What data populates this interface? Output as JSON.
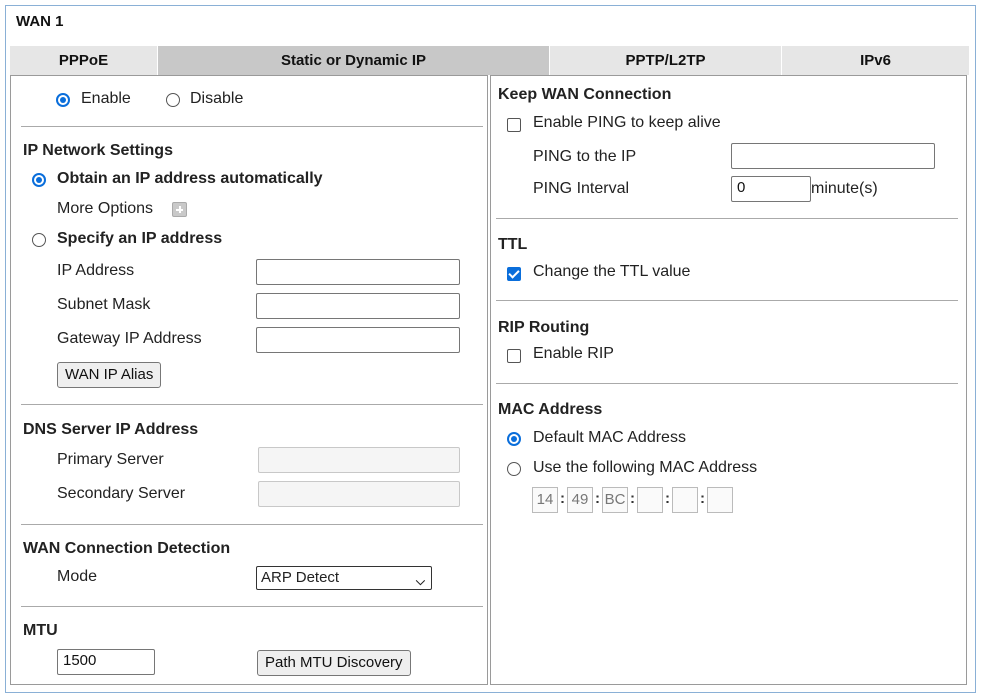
{
  "wan": {
    "title": "WAN 1"
  },
  "tabs": [
    {
      "label": "PPPoE"
    },
    {
      "label": "Static or Dynamic IP"
    },
    {
      "label": "PPTP/L2TP"
    },
    {
      "label": "IPv6"
    }
  ],
  "left": {
    "enable_label": "Enable",
    "disable_label": "Disable",
    "ip_network": {
      "title": "IP Network Settings",
      "obtain_label": "Obtain an IP address automatically",
      "more_options_label": "More Options",
      "specify_label": "Specify an IP address",
      "ip_address_label": "IP Address",
      "subnet_mask_label": "Subnet Mask",
      "gateway_label": "Gateway IP Address",
      "alias_button": "WAN IP Alias"
    },
    "dns": {
      "title": "DNS Server IP Address",
      "primary_label": "Primary Server",
      "secondary_label": "Secondary Server"
    },
    "detection": {
      "title": "WAN Connection Detection",
      "mode_label": "Mode",
      "mode_value": "ARP Detect"
    },
    "mtu": {
      "title": "MTU",
      "value": "1500",
      "discovery_button": "Path MTU Discovery"
    }
  },
  "right": {
    "keep": {
      "title": "Keep WAN Connection",
      "ping_keep_label": "Enable PING to keep alive",
      "ping_ip_label": "PING to the IP",
      "ping_interval_label": "PING Interval",
      "ping_interval_value": "0",
      "unit_label": "minute(s)"
    },
    "ttl": {
      "title": "TTL",
      "change_label": "Change the TTL value"
    },
    "rip": {
      "title": "RIP Routing",
      "enable_label": "Enable RIP"
    },
    "mac": {
      "title": "MAC Address",
      "default_label": "Default MAC Address",
      "use_following_label": "Use the following MAC Address",
      "octets": [
        "14",
        "49",
        "BC",
        "",
        "",
        ""
      ]
    }
  },
  "colors": {
    "accent": "#0a6edb",
    "frame_border": "#8ab0d6",
    "tab_bg": "#e6e6e6",
    "tab_active_bg": "#c8c8c8"
  }
}
